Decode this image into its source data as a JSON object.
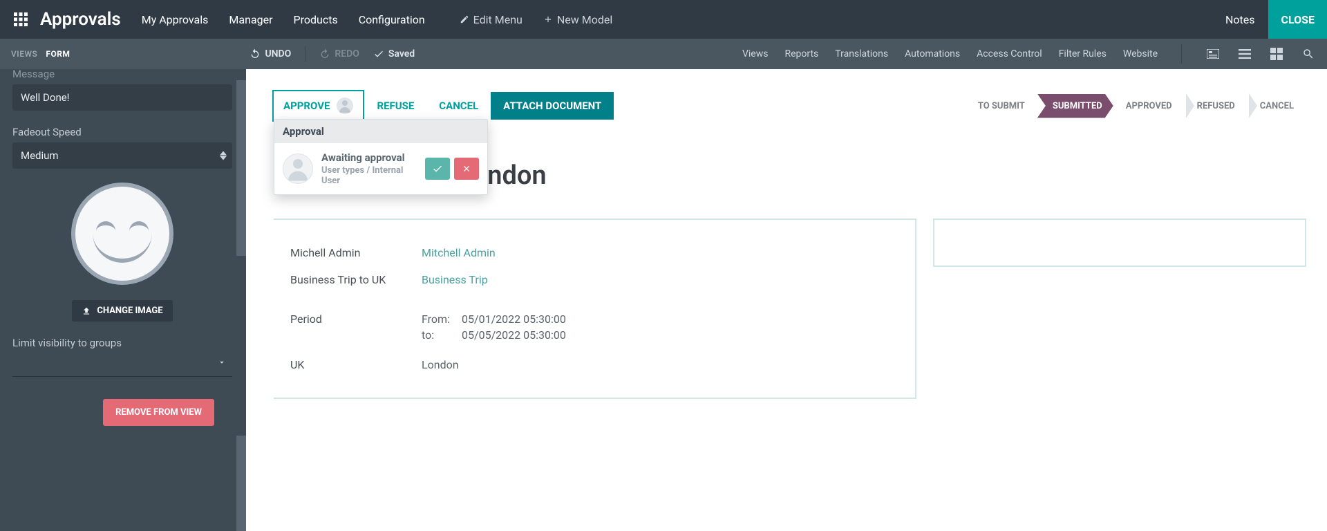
{
  "topbar": {
    "title": "Approvals",
    "menu": [
      "My Approvals",
      "Manager",
      "Products",
      "Configuration"
    ],
    "edit_menu": "Edit Menu",
    "new_model": "New Model",
    "notes": "Notes",
    "close": "CLOSE"
  },
  "secondbar": {
    "views": "VIEWS",
    "form": "FORM",
    "undo": "UNDO",
    "redo": "REDO",
    "saved": "Saved",
    "links": [
      "Views",
      "Reports",
      "Translations",
      "Automations",
      "Access Control",
      "Filter Rules",
      "Website"
    ]
  },
  "sidebar": {
    "message_label": "Message",
    "message_value": "Well Done!",
    "fadeout_label": "Fadeout Speed",
    "fadeout_value": "Medium",
    "change_image": "CHANGE IMAGE",
    "visibility_label": "Limit visibility to groups",
    "remove": "REMOVE FROM VIEW"
  },
  "actions": {
    "approve": "APPROVE",
    "refuse": "REFUSE",
    "cancel": "CANCEL",
    "attach": "ATTACH DOCUMENT"
  },
  "popover": {
    "head": "Approval",
    "title": "Awaiting approval",
    "sub": "User types / Internal User"
  },
  "status": {
    "steps": [
      "TO SUBMIT",
      "SUBMITTED",
      "APPROVED",
      "REFUSED",
      "CANCEL"
    ],
    "active": "SUBMITTED"
  },
  "form": {
    "title_suffix": " to London",
    "rows": {
      "r1_label": "Michell Admin",
      "r1_value": "Mitchell Admin",
      "r2_label": "Business Trip to UK",
      "r2_value": "Business Trip",
      "period_label": "Period",
      "from_lbl": "From:",
      "from_val": "05/01/2022 05:30:00",
      "to_lbl": "to:",
      "to_val": "05/05/2022 05:30:00",
      "loc_label": "UK",
      "loc_value": "London"
    }
  }
}
